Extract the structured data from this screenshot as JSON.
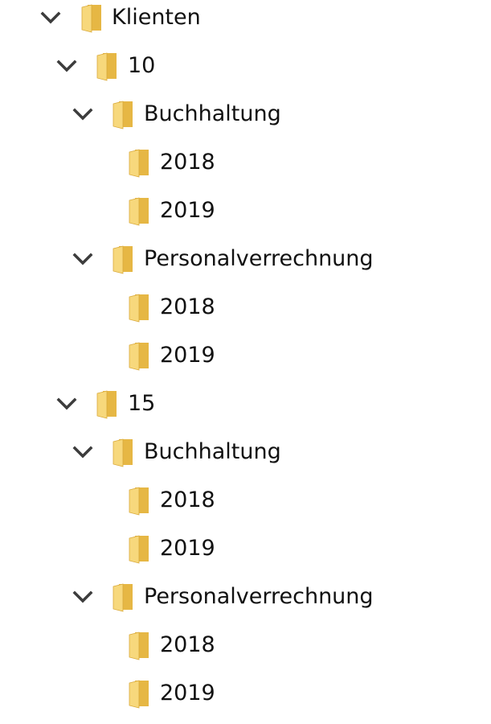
{
  "icons": {
    "expand": "chevron-down-icon",
    "folder": "folder-icon"
  },
  "colors": {
    "folder_front": "#F7D87C",
    "folder_back": "#E6B744",
    "chevron": "#3C3C3C",
    "text": "#111111"
  },
  "tree": {
    "root": {
      "label": "Klienten",
      "expanded": true,
      "children": [
        {
          "label": "10",
          "expanded": true,
          "children": [
            {
              "label": "Buchhaltung",
              "expanded": true,
              "children": [
                {
                  "label": "2018"
                },
                {
                  "label": "2019"
                }
              ]
            },
            {
              "label": "Personalverrechnung",
              "expanded": true,
              "children": [
                {
                  "label": "2018"
                },
                {
                  "label": "2019"
                }
              ]
            }
          ]
        },
        {
          "label": "15",
          "expanded": true,
          "children": [
            {
              "label": "Buchhaltung",
              "expanded": true,
              "children": [
                {
                  "label": "2018"
                },
                {
                  "label": "2019"
                }
              ]
            },
            {
              "label": "Personalverrechnung",
              "expanded": true,
              "children": [
                {
                  "label": "2018"
                },
                {
                  "label": "2019"
                }
              ]
            }
          ]
        }
      ]
    }
  }
}
